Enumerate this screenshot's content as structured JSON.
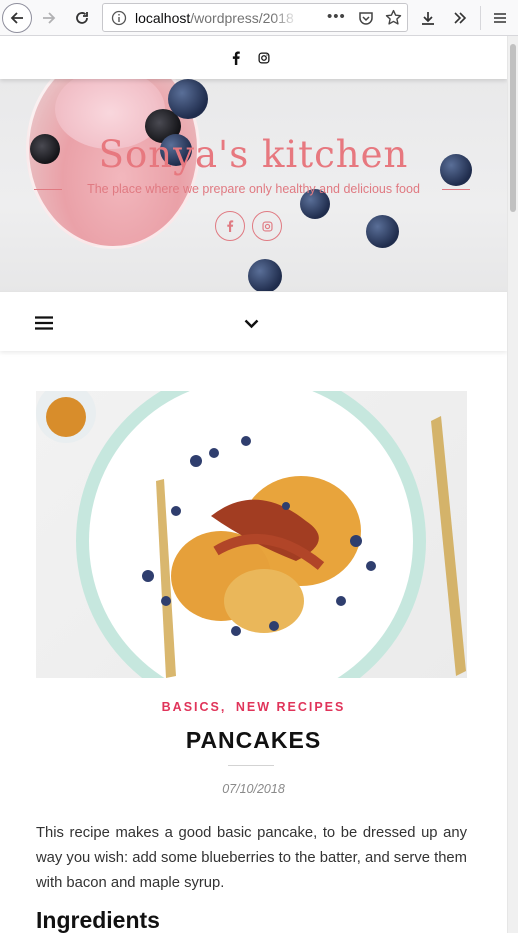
{
  "browser": {
    "url_host": "localhost",
    "url_path": "/wordpress/2018",
    "icons": [
      "back-icon",
      "forward-icon",
      "reload-icon",
      "info-icon",
      "page-actions-icon",
      "pocket-icon",
      "bookmark-star-icon",
      "download-icon",
      "overflow-icon",
      "menu-icon"
    ]
  },
  "site": {
    "title": "Sonya's kitchen",
    "tagline": "The place where we prepare only healthy and delicious food",
    "social": [
      "facebook-icon",
      "instagram-icon"
    ]
  },
  "post": {
    "categories": [
      "BASICS,",
      "NEW RECIPES"
    ],
    "title": "PANCAKES",
    "date": "07/10/2018",
    "excerpt": "This recipe makes a good basic pancake, to be dressed up any way you wish: add some blueberries to the batter, and serve them with bacon and maple syrup.",
    "heading": "Ingredients"
  },
  "colors": {
    "accent": "#e0345a",
    "hero_text": "#e7787f"
  }
}
